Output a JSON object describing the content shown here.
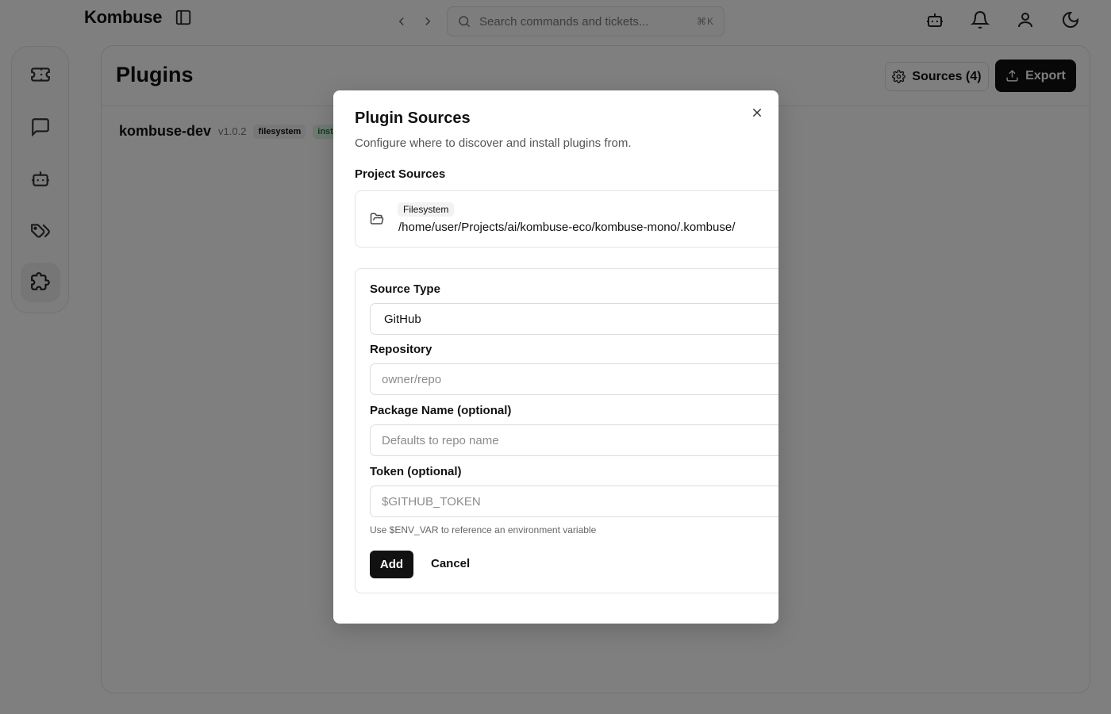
{
  "app": {
    "title": "Kombuse"
  },
  "search": {
    "placeholder": "Search commands and tickets...",
    "shortcut": "⌘K"
  },
  "topbar_icons": [
    "bot-icon",
    "bell-icon",
    "user-icon",
    "moon-icon"
  ],
  "sidebar": {
    "items": [
      {
        "name": "tickets",
        "icon": "ticket-icon",
        "active": false
      },
      {
        "name": "chat",
        "icon": "message-icon",
        "active": false
      },
      {
        "name": "agents",
        "icon": "bot-icon",
        "active": false
      },
      {
        "name": "labels",
        "icon": "tags-icon",
        "active": false
      },
      {
        "name": "plugins",
        "icon": "puzzle-icon",
        "active": true
      }
    ]
  },
  "main": {
    "title": "Plugins",
    "sources_button": "Sources (4)",
    "export_button": "Export",
    "plugins": [
      {
        "name": "kombuse-dev",
        "version": "v1.0.2",
        "source": "filesystem",
        "status": "inst"
      }
    ]
  },
  "modal": {
    "title": "Plugin Sources",
    "description": "Configure where to discover and install plugins from.",
    "project_sources_label": "Project Sources",
    "sources": [
      {
        "type": "Filesystem",
        "path": "/home/user/Projects/ai/kombuse-eco/kombuse-mono/.kombuse/"
      }
    ],
    "form": {
      "source_type_label": "Source Type",
      "source_type_value": "GitHub",
      "repository_label": "Repository",
      "repository_placeholder": "owner/repo",
      "package_label": "Package Name (optional)",
      "package_placeholder": "Defaults to repo name",
      "token_label": "Token (optional)",
      "token_placeholder": "$GITHUB_TOKEN",
      "token_hint": "Use $ENV_VAR to reference an environment variable",
      "add_button": "Add",
      "cancel_button": "Cancel"
    }
  },
  "colors": {
    "accent": "#111111",
    "overlay": "rgba(0,0,0,0.5)",
    "installed_badge": "#1e7a3c"
  }
}
